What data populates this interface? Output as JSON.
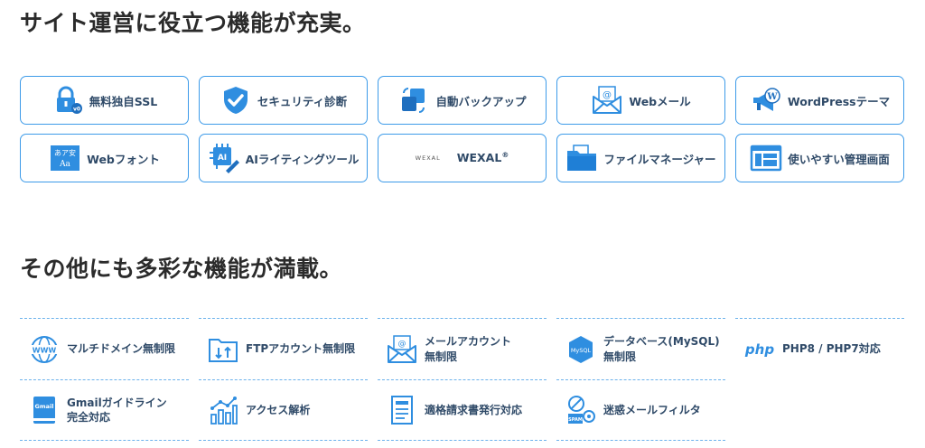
{
  "section1": {
    "title": "サイト運営に役立つ機能が充実。",
    "cards": [
      {
        "label": "無料独自SSL",
        "icon": "ssl-lock-icon"
      },
      {
        "label": "セキュリティ診断",
        "icon": "shield-check-icon"
      },
      {
        "label": "自動バックアップ",
        "icon": "backup-sync-icon"
      },
      {
        "label": "Webメール",
        "icon": "mail-envelope-icon"
      },
      {
        "label": "WordPressテーマ",
        "icon": "wordpress-megaphone-icon"
      },
      {
        "label": "Webフォント",
        "icon": "web-font-icon",
        "icon_text": "あア安\nAa"
      },
      {
        "label": "AIライティングツール",
        "icon": "ai-chip-pen-icon",
        "icon_text": "AI"
      },
      {
        "label": "WEXAL",
        "sup": "®",
        "small": "WEXAL",
        "icon": "wexal-logo-icon"
      },
      {
        "label": "ファイルマネージャー",
        "icon": "folder-icon"
      },
      {
        "label": "使いやすい管理画面",
        "icon": "admin-screen-icon"
      }
    ]
  },
  "section2": {
    "title": "その他にも多彩な機能が満載。",
    "items": [
      {
        "label": "マルチドメイン無制限",
        "icon": "www-globe-icon",
        "icon_text": "WWW"
      },
      {
        "label": "FTPアカウント無制限",
        "icon": "ftp-folder-icon"
      },
      {
        "label": "メールアカウント\n無制限",
        "icon": "mail-account-icon"
      },
      {
        "label": "データベース(MySQL)\n無制限",
        "icon": "mysql-database-icon",
        "icon_text": "MySQL"
      },
      {
        "label": "PHP8 / PHP7対応",
        "icon": "php-icon",
        "icon_text": "php"
      },
      {
        "label": "Gmailガイドライン\n完全対応",
        "icon": "gmail-book-icon",
        "icon_text": "Gmail"
      },
      {
        "label": "アクセス解析",
        "icon": "analytics-chart-icon"
      },
      {
        "label": "適格請求書発行対応",
        "icon": "invoice-icon"
      },
      {
        "label": "迷惑メールフィルタ",
        "icon": "spam-filter-icon",
        "icon_text": "SPAM"
      }
    ]
  },
  "colors": {
    "accent": "#3d9be9",
    "icon_blue": "#2f8ee0",
    "text": "#2f4a68",
    "title": "#2b2b2b"
  }
}
